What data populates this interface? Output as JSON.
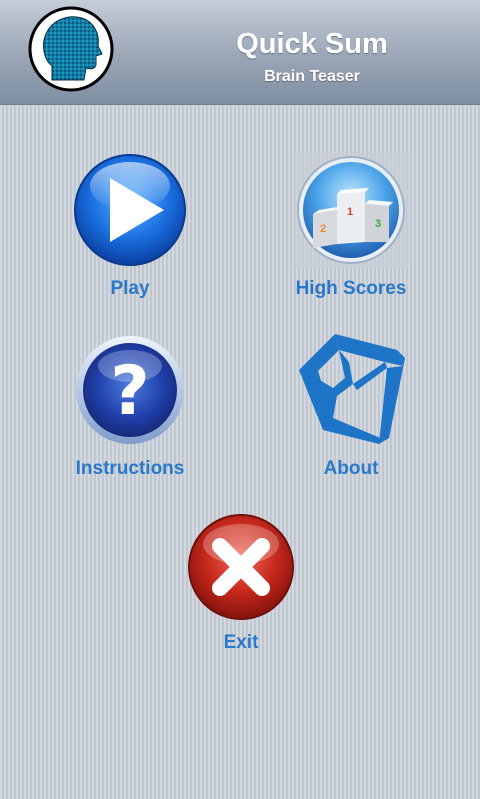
{
  "header": {
    "title": "Quick Sum",
    "subtitle": "Brain Teaser",
    "logo_icon": "brain-head-icon"
  },
  "menu": {
    "play": {
      "label": "Play",
      "icon": "play-icon"
    },
    "high_scores": {
      "label": "High Scores",
      "icon": "podium-icon",
      "podium_numbers": [
        "1",
        "2",
        "3"
      ]
    },
    "instructions": {
      "label": "Instructions",
      "icon": "question-icon"
    },
    "about": {
      "label": "About",
      "icon": "cube-icon"
    },
    "exit": {
      "label": "Exit",
      "icon": "close-icon"
    }
  },
  "colors": {
    "label": "#2a78c8",
    "header_top": "#c4ccd7",
    "header_bottom": "#7f8ea3"
  }
}
